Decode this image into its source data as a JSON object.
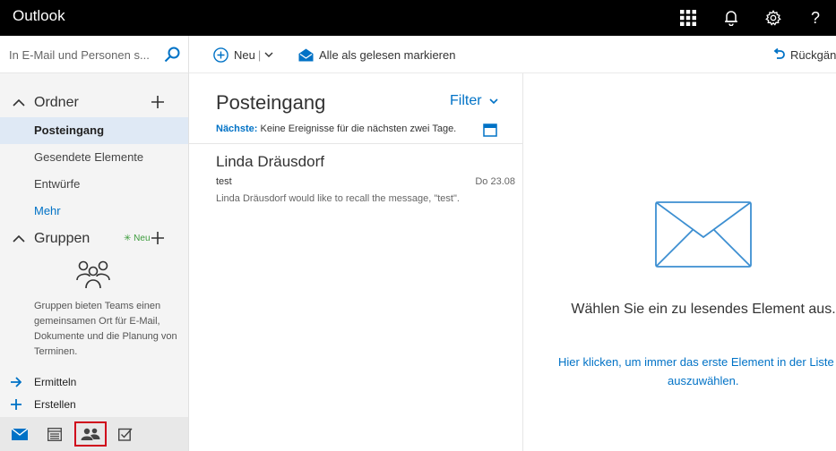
{
  "header": {
    "app_title": "Outlook",
    "icons": [
      "app-launcher-icon",
      "bell-icon",
      "gear-icon",
      "help-icon"
    ],
    "help_glyph": "?"
  },
  "search": {
    "placeholder": "In E-Mail und Personen s..."
  },
  "folders": {
    "heading": "Ordner",
    "items": [
      {
        "label": "Posteingang",
        "selected": true
      },
      {
        "label": "Gesendete Elemente",
        "selected": false
      },
      {
        "label": "Entwürfe",
        "selected": false
      }
    ],
    "more_label": "Mehr"
  },
  "groups": {
    "heading": "Gruppen",
    "new_badge": "✳ Neu",
    "description": "Gruppen bieten Teams einen gemeinsamen Ort für E-Mail, Dokumente und die Planung von Terminen.",
    "actions": [
      {
        "label": "Ermitteln",
        "icon": "arrow-right-icon"
      },
      {
        "label": "Erstellen",
        "icon": "plus-icon"
      }
    ]
  },
  "bottom_nav": {
    "items": [
      "mail-icon",
      "calendar-icon",
      "people-icon",
      "tasks-icon"
    ],
    "active": "people-icon"
  },
  "commands": {
    "new_label": "Neu",
    "mark_all_read_label": "Alle als gelesen markieren",
    "undo_label": "Rückgängig"
  },
  "message_list": {
    "title": "Posteingang",
    "filter_label": "Filter",
    "agenda_label": "Nächste:",
    "agenda_text": "Keine Ereignisse für die nächsten zwei Tage.",
    "messages": [
      {
        "sender": "Linda Dräusdorf",
        "subject": "test",
        "date": "Do 23.08",
        "preview": "Linda Dräusdorf would like to recall the message, \"test\"."
      }
    ]
  },
  "reading_pane": {
    "message": "Wählen Sie ein zu lesendes Element aus.",
    "link_line1": "Hier klicken, um immer das erste Element in der Liste",
    "link_line2": "auszuwählen."
  },
  "colors": {
    "topbar": "#000000",
    "accent": "#0072c6",
    "selected_folder": "#dfe9f5",
    "new_badge": "#3c9c3c",
    "active_nav_border": "#d0021b"
  }
}
